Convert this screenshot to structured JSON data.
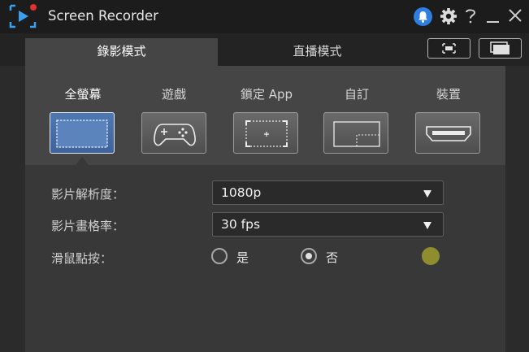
{
  "app": {
    "title": "Screen Recorder"
  },
  "tabs": [
    {
      "label": "錄影模式",
      "active": true
    },
    {
      "label": "直播模式",
      "active": false
    }
  ],
  "title_icons": [
    "notification-bell-icon",
    "settings-gear-icon",
    "help-icon",
    "minimize-icon",
    "close-icon"
  ],
  "capture_modes": [
    {
      "label": "全螢幕",
      "icon": "fullscreen-icon",
      "active": true
    },
    {
      "label": "遊戲",
      "icon": "gamepad-icon",
      "active": false
    },
    {
      "label": "鎖定 App",
      "icon": "lock-app-icon",
      "active": false
    },
    {
      "label": "自訂",
      "icon": "custom-region-icon",
      "active": false
    },
    {
      "label": "裝置",
      "icon": "device-hdmi-icon",
      "active": false
    }
  ],
  "settings": {
    "resolution": {
      "label": "影片解析度：",
      "value": "1080p"
    },
    "framerate": {
      "label": "影片畫格率：",
      "value": "30 fps"
    },
    "mouse_click": {
      "label": "滑鼠點按：",
      "options": [
        {
          "label": "是",
          "checked": false
        },
        {
          "label": "否",
          "checked": true
        }
      ],
      "highlight_color": "#8f8d2e"
    }
  },
  "colors": {
    "accent": "#3f639a",
    "bell": "#2d7fe0",
    "background": "#2b2b2b"
  }
}
